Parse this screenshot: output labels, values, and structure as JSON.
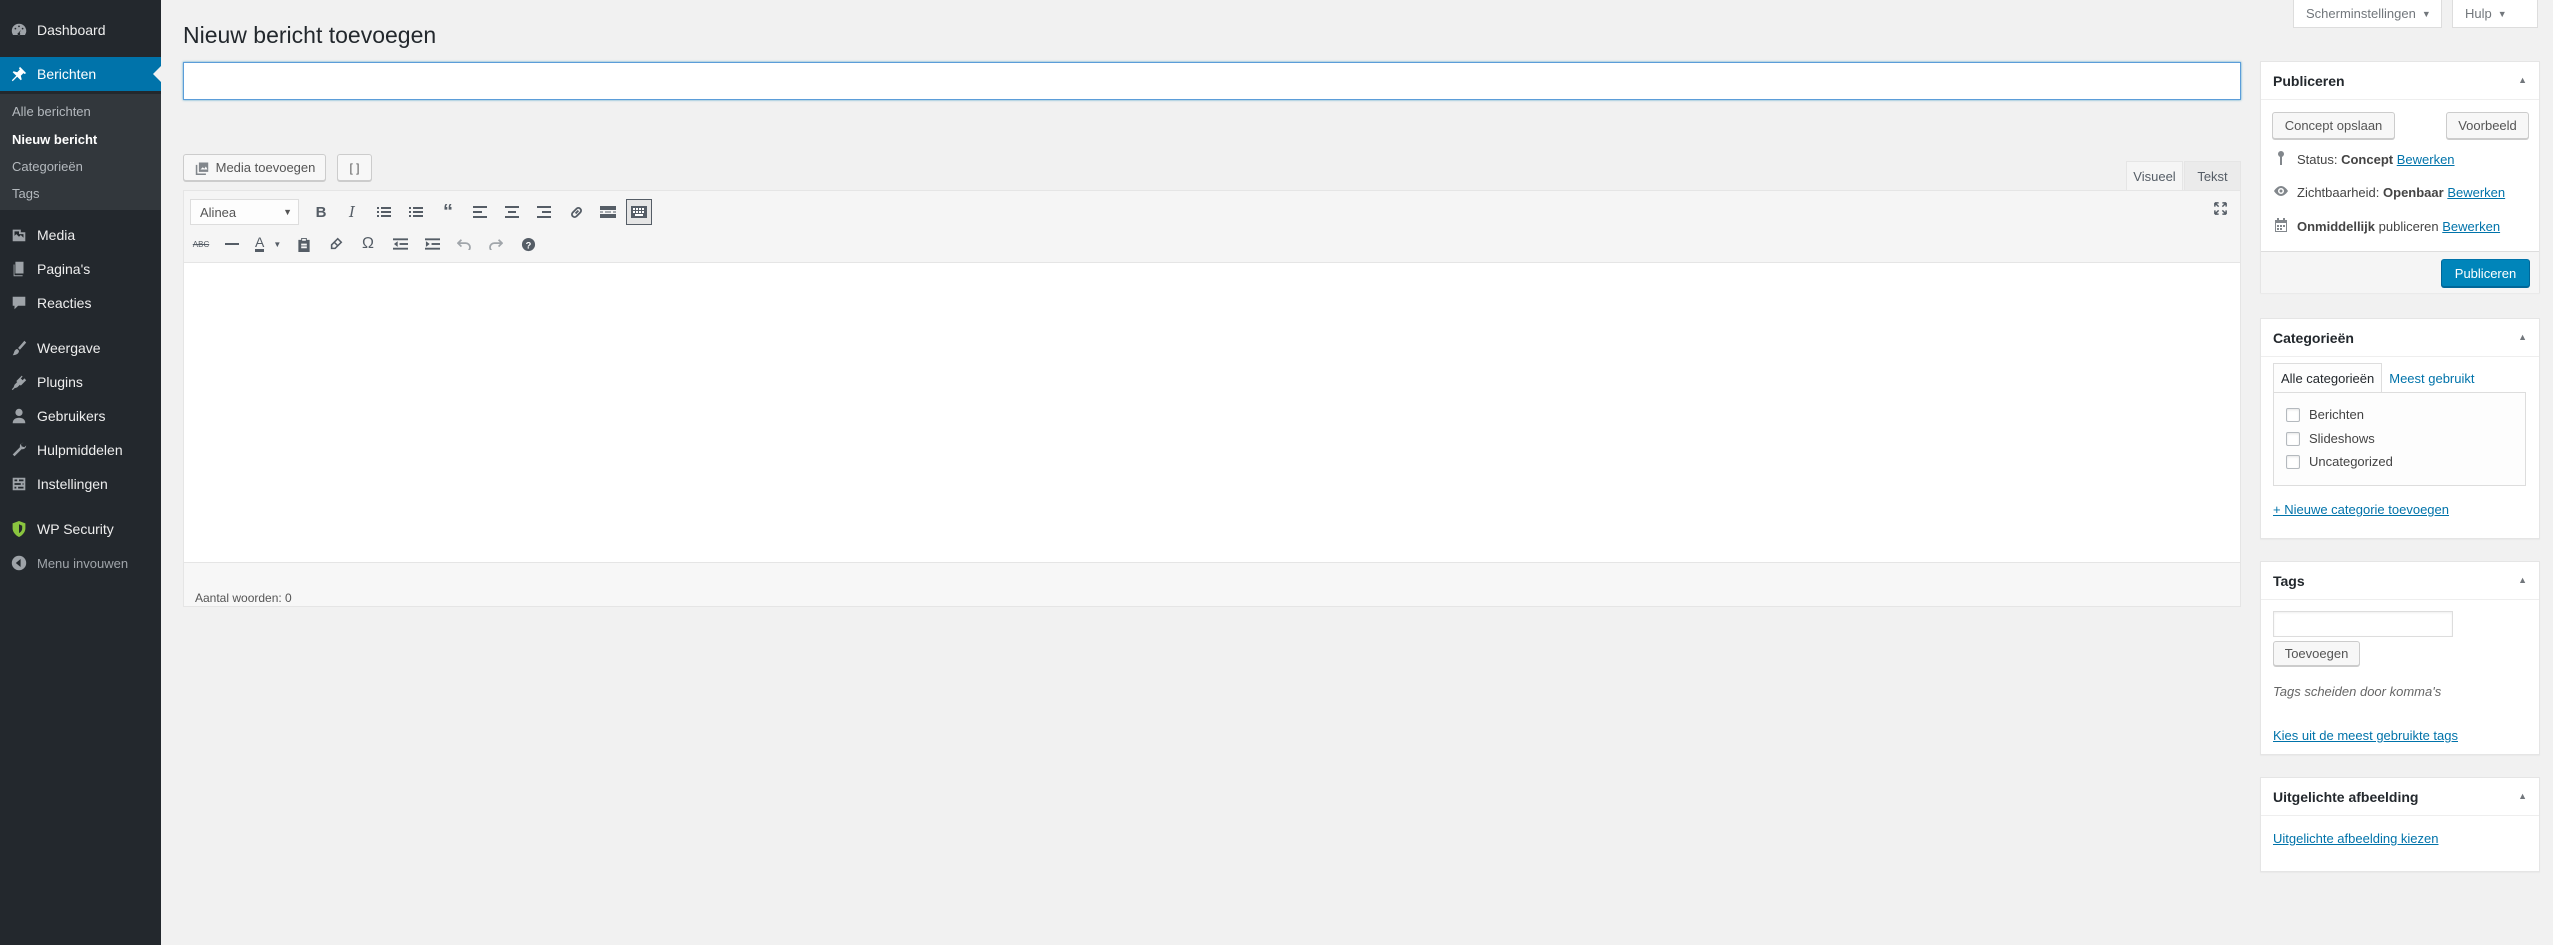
{
  "sidebar": {
    "items": [
      {
        "label": "Dashboard",
        "icon": "dashboard-icon"
      },
      {
        "label": "Berichten",
        "icon": "pin-icon"
      },
      {
        "label": "Media",
        "icon": "media-icon"
      },
      {
        "label": "Pagina's",
        "icon": "pages-icon"
      },
      {
        "label": "Reacties",
        "icon": "comments-icon"
      },
      {
        "label": "Weergave",
        "icon": "appearance-icon"
      },
      {
        "label": "Plugins",
        "icon": "plugins-icon"
      },
      {
        "label": "Gebruikers",
        "icon": "users-icon"
      },
      {
        "label": "Hulpmiddelen",
        "icon": "tools-icon"
      },
      {
        "label": "Instellingen",
        "icon": "settings-icon"
      },
      {
        "label": "WP Security",
        "icon": "shield-icon"
      },
      {
        "label": "Menu invouwen",
        "icon": "collapse-icon"
      }
    ],
    "submenu": [
      "Alle berichten",
      "Nieuw bericht",
      "Categorieën",
      "Tags"
    ]
  },
  "screen_options": "Scherminstellingen",
  "help": "Hulp",
  "page_title": "Nieuw bericht toevoegen",
  "title_input": {
    "value": "",
    "placeholder": ""
  },
  "editor": {
    "add_media": "Media toevoegen",
    "shortcode": "[ ]",
    "tab_visual": "Visueel",
    "tab_text": "Tekst",
    "format": "Alinea",
    "word_count": "Aantal woorden: 0"
  },
  "publish": {
    "title": "Publiceren",
    "save_draft": "Concept opslaan",
    "preview": "Voorbeeld",
    "status_label": "Status:",
    "status_value": "Concept",
    "visibility_label": "Zichtbaarheid:",
    "visibility_value": "Openbaar",
    "schedule_value": "Onmiddellijk",
    "schedule_label": "publiceren",
    "edit": "Bewerken",
    "publish_button": "Publiceren"
  },
  "categories": {
    "title": "Categorieën",
    "tab_all": "Alle categorieën",
    "tab_popular": "Meest gebruikt",
    "items": [
      "Berichten",
      "Slideshows",
      "Uncategorized"
    ],
    "add_new": "+ Nieuwe categorie toevoegen"
  },
  "tags": {
    "title": "Tags",
    "input_value": "",
    "add_button": "Toevoegen",
    "hint": "Tags scheiden door komma's",
    "choose_popular": "Kies uit de meest gebruikte tags"
  },
  "featured_image": {
    "title": "Uitgelichte afbeelding",
    "set_link": "Uitgelichte afbeelding kiezen"
  },
  "colors": {
    "sidebar_bg": "#23282d",
    "active_blue": "#0073aa",
    "primary_button": "#0085ba"
  }
}
